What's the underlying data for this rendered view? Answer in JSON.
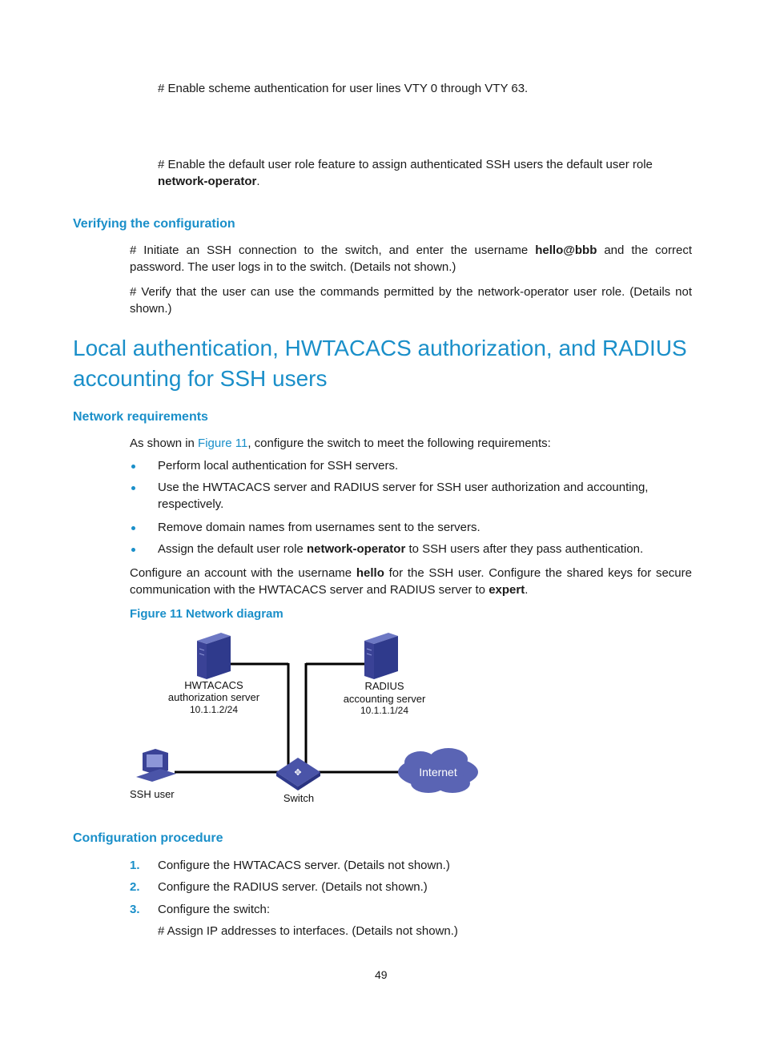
{
  "intro": {
    "p1": "# Enable scheme authentication for user lines VTY 0 through VTY 63.",
    "p2_text": "# Enable the default user role feature to assign authenticated SSH users the default user role ",
    "p2_bold": "network-operator",
    "p2_end": "."
  },
  "verify": {
    "heading": "Verifying the configuration",
    "p1_a": "# Initiate an SSH connection to the switch, and enter the username ",
    "p1_bold": "hello@bbb",
    "p1_b": " and the correct password. The user logs in to the switch. (Details not shown.)",
    "p2": "# Verify that the user can use the commands permitted by the network-operator user role. (Details not shown.)"
  },
  "section": {
    "title": "Local authentication, HWTACACS authorization, and RADIUS accounting for SSH users"
  },
  "network_requirements": {
    "heading": "Network requirements",
    "intro_a": "As shown in ",
    "intro_link": "Figure 11",
    "intro_b": ", configure the switch to meet the following requirements:",
    "bullets": [
      "Perform local authentication for SSH servers.",
      "Use the HWTACACS server and RADIUS server for SSH user authorization and accounting, respectively.",
      "Remove domain names from usernames sent to the servers."
    ],
    "bullet4_a": "Assign the default user role ",
    "bullet4_bold": "network-operator",
    "bullet4_b": " to SSH users after they pass authentication.",
    "config_a": "Configure an account with the username ",
    "config_bold1": "hello",
    "config_b": " for the SSH user. Configure the shared keys for secure communication with the HWTACACS server and RADIUS server to ",
    "config_bold2": "expert",
    "config_c": ".",
    "figure_caption": "Figure 11 Network diagram"
  },
  "diagram": {
    "hwtacacs_label1": "HWTACACS",
    "hwtacacs_label2": "authorization server",
    "hwtacacs_ip": "10.1.1.2/24",
    "radius_label1": "RADIUS",
    "radius_label2": "accounting server",
    "radius_ip": "10.1.1.1/24",
    "ssh_user": "SSH user",
    "switch": "Switch",
    "internet": "Internet"
  },
  "procedure": {
    "heading": "Configuration procedure",
    "steps": [
      {
        "num": "1.",
        "text": "Configure the HWTACACS server. (Details not shown.)"
      },
      {
        "num": "2.",
        "text": "Configure the RADIUS server. (Details not shown.)"
      },
      {
        "num": "3.",
        "text": "Configure the switch:"
      }
    ],
    "sub": "# Assign IP addresses to interfaces. (Details not shown.)"
  },
  "page_number": "49"
}
